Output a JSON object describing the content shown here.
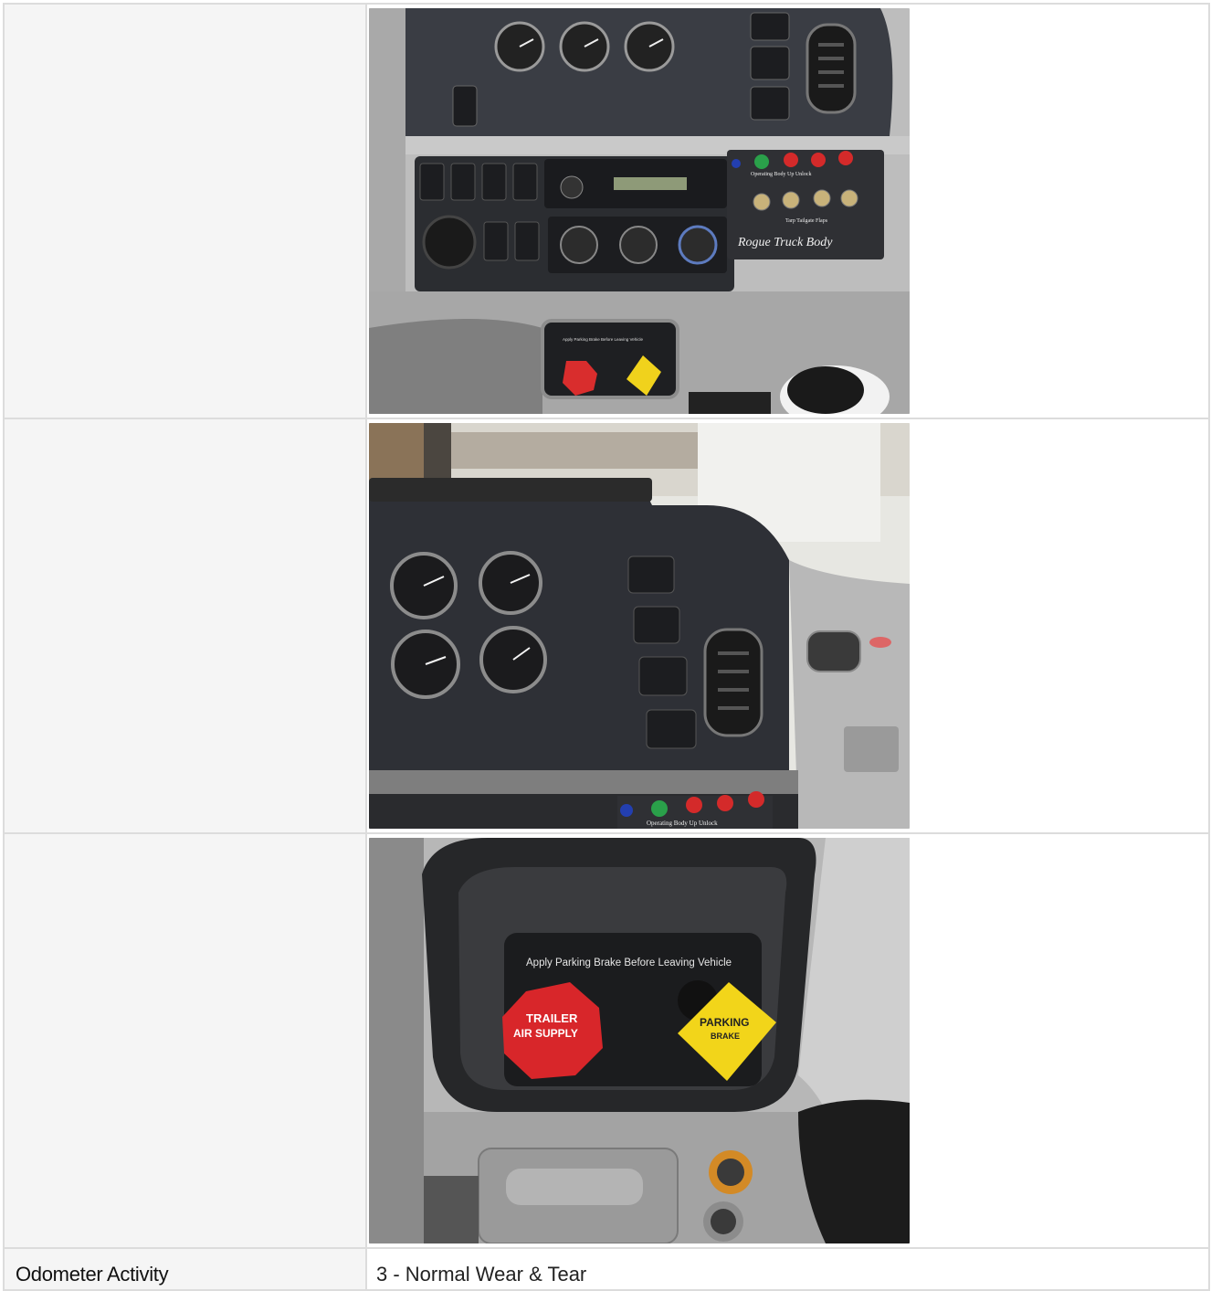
{
  "rows": [
    {
      "type": "photo",
      "label": "",
      "photo": {
        "kind": "dashboard-center-console-photo",
        "text": [
          "Operating",
          "Body Up",
          "Unlock",
          "Tarp",
          "Tailgate",
          "Flaps",
          "Rogue Truck Body",
          "Apply Parking Brake Before Leaving Vehicle"
        ]
      }
    },
    {
      "type": "photo",
      "label": "",
      "photo": {
        "kind": "dashboard-gauges-photo",
        "text": [
          "Operating",
          "Body Up",
          "Unlock"
        ]
      }
    },
    {
      "type": "photo",
      "label": "",
      "photo": {
        "kind": "parking-brake-valves-photo",
        "text": [
          "Apply Parking Brake Before Leaving Vehicle",
          "TRAILER",
          "AIR SUPPLY",
          "PARKING",
          "BRAKE"
        ]
      }
    },
    {
      "type": "text",
      "label": "Odometer Activity",
      "value": "3 - Normal Wear & Tear"
    }
  ],
  "colors": {
    "border": "#dcdcdc",
    "label_bg": "#f5f5f5",
    "text": "#111111"
  }
}
